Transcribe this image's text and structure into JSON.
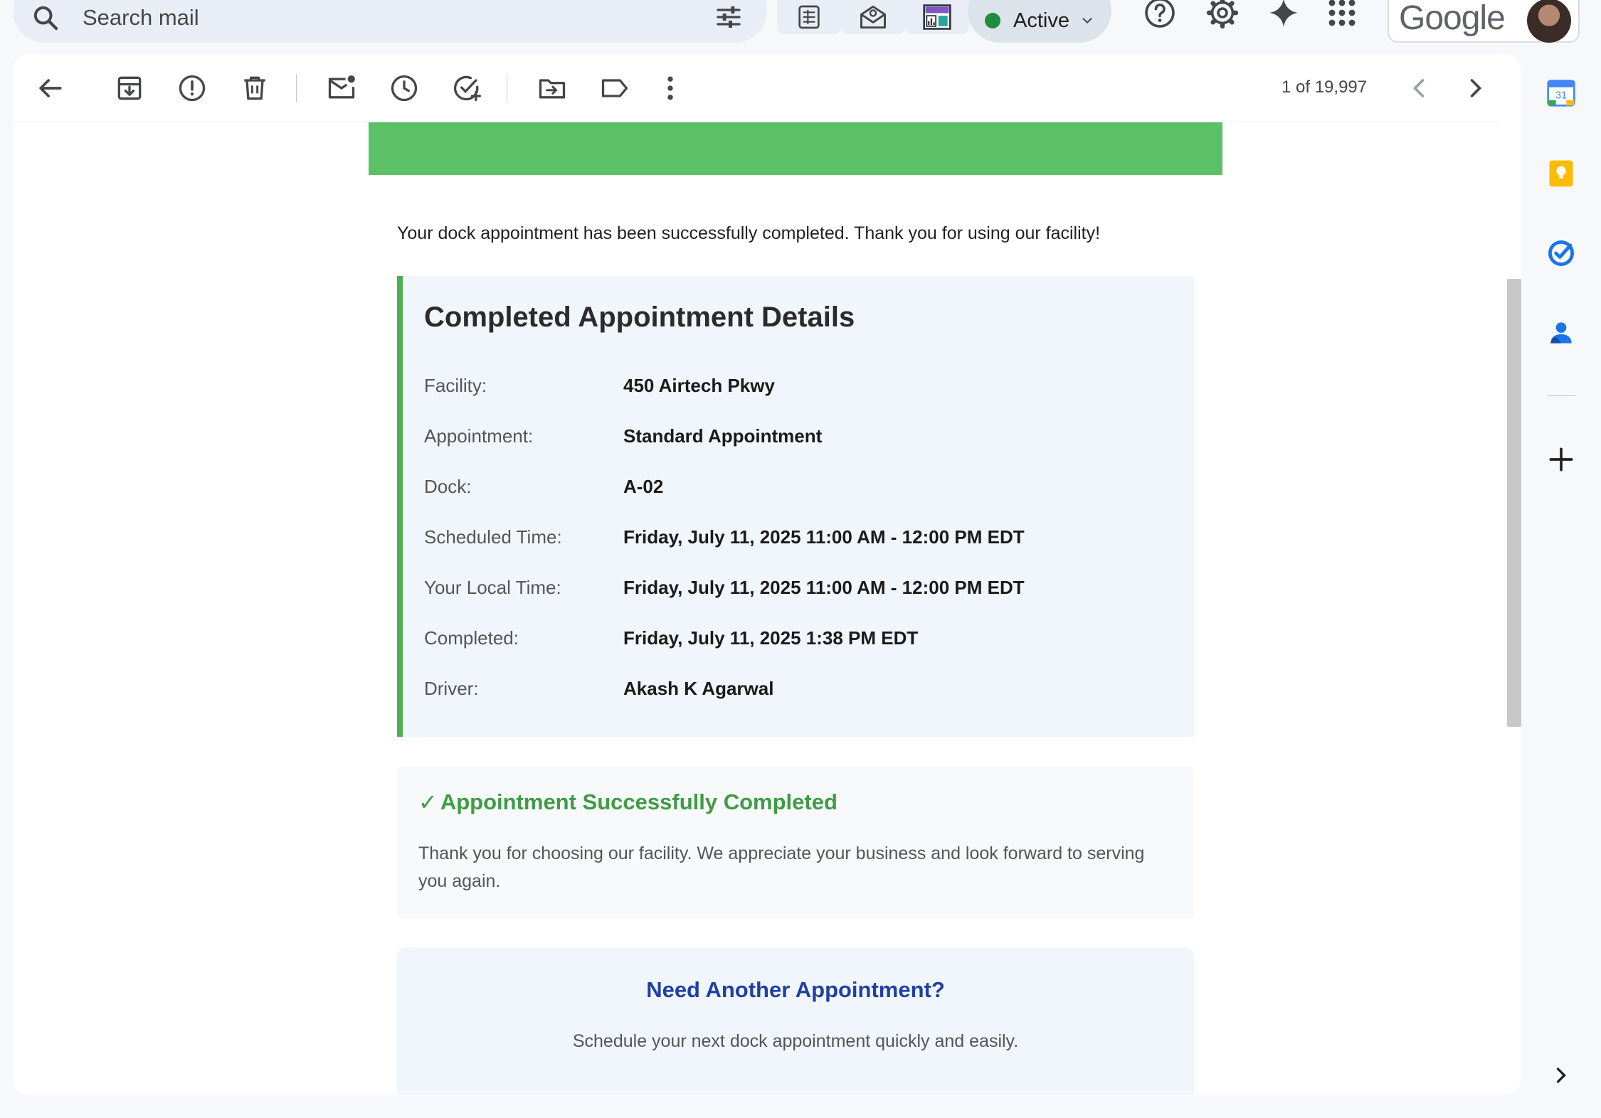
{
  "search": {
    "placeholder": "Search mail"
  },
  "status": {
    "label": "Active",
    "dot_color": "#1e8e3e"
  },
  "account": {
    "wordmark": "Google"
  },
  "toolbar": {
    "page_count": "1 of 19,997",
    "buttons": [
      "back-icon",
      "archive-icon",
      "report-spam-icon",
      "delete-icon",
      "mark-unread-icon",
      "snooze-icon",
      "add-task-icon",
      "move-to-icon",
      "label-icon",
      "more-icon",
      "newer-icon",
      "older-icon"
    ]
  },
  "email": {
    "banner_color": "#5cc166",
    "intro": "Your dock appointment has been successfully completed. Thank you for using our facility!",
    "details": {
      "title": "Completed Appointment Details",
      "rows": [
        {
          "label": "Facility:",
          "value": "450 Airtech Pkwy"
        },
        {
          "label": "Appointment:",
          "value": "Standard Appointment"
        },
        {
          "label": "Dock:",
          "value": "A-02"
        },
        {
          "label": "Scheduled Time:",
          "value": "Friday, July 11, 2025 11:00 AM - 12:00 PM EDT"
        },
        {
          "label": "Your Local Time:",
          "value": "Friday, July 11, 2025 11:00 AM - 12:00 PM EDT"
        },
        {
          "label": "Completed:",
          "value": "Friday, July 11, 2025 1:38 PM EDT"
        },
        {
          "label": "Driver:",
          "value": "Akash K Agarwal"
        }
      ]
    },
    "success": {
      "check": "✓",
      "title": "Appointment Successfully Completed",
      "text": "Thank you for choosing our facility. We appreciate your business and look forward to serving you again."
    },
    "another": {
      "title": "Need Another Appointment?",
      "text": "Schedule your next dock appointment quickly and easily."
    }
  },
  "side_panel": {
    "calendar_day": "31",
    "apps": [
      "calendar-icon",
      "keep-icon",
      "tasks-icon",
      "contacts-icon",
      "add-icon"
    ]
  }
}
